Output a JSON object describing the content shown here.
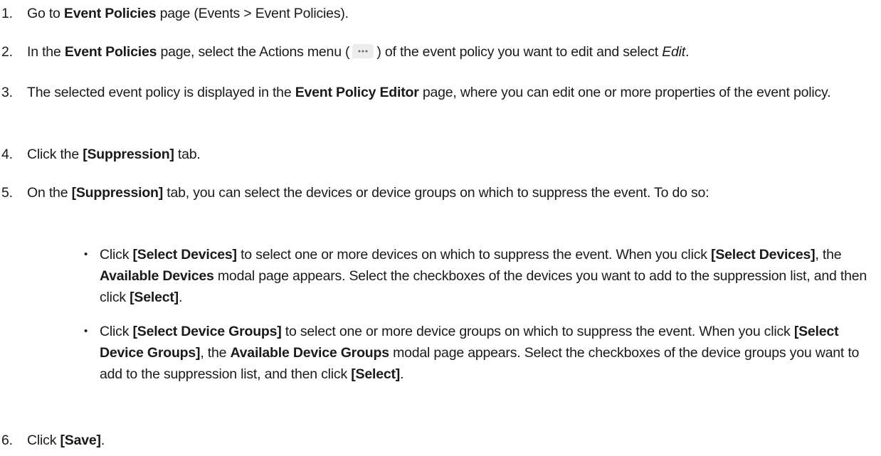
{
  "steps": [
    {
      "num": "1.",
      "a": "Go to ",
      "b1": "Event Policies",
      "c": " page (Events > Event Policies)."
    },
    {
      "num": "2.",
      "a": "In the ",
      "b1": "Event Policies",
      "c": " page, select the Actions menu (",
      "d": ") of the event policy you want to edit and select ",
      "e": "Edit",
      "f": "."
    },
    {
      "num": "3.",
      "a": "The selected event policy is displayed in the ",
      "b1": "Event Policy Editor",
      "c": " page, where you can edit one or more properties of the event policy."
    },
    {
      "num": "4.",
      "a": "Click the ",
      "b1": "[Suppression]",
      "c": " tab."
    },
    {
      "num": "5.",
      "a": "On the ",
      "b1": "[Suppression]",
      "c": " tab, you can select the devices or device groups on which to suppress the event. To do so:"
    },
    {
      "num": "6.",
      "a": "Click ",
      "b1": "[Save]",
      "c": "."
    }
  ],
  "bullets": [
    {
      "dot": "•",
      "a": "Click ",
      "b1": "[Select Devices]",
      "c": " to select one or more devices on which to suppress the event. When you click ",
      "d": "[Select Devices]",
      "e": ", the ",
      "f": "Available Devices",
      "g": " modal page appears. Select the checkboxes of the devices you want to add to the suppression list, and then click ",
      "h": "[Select]",
      "i": "."
    },
    {
      "dot": "•",
      "a": "Click ",
      "b1": "[Select Device Groups]",
      "c": " to select one or more device groups on which to suppress the event. When you click ",
      "d": "[Select Device Groups]",
      "e": ", the ",
      "f": "Available Device Groups",
      "g": " modal page appears. Select the checkboxes of the device groups you want to add to the suppression list, and then click ",
      "h": "[Select]",
      "i": "."
    }
  ],
  "icons": {
    "actions_menu": "more-horizontal-icon"
  }
}
